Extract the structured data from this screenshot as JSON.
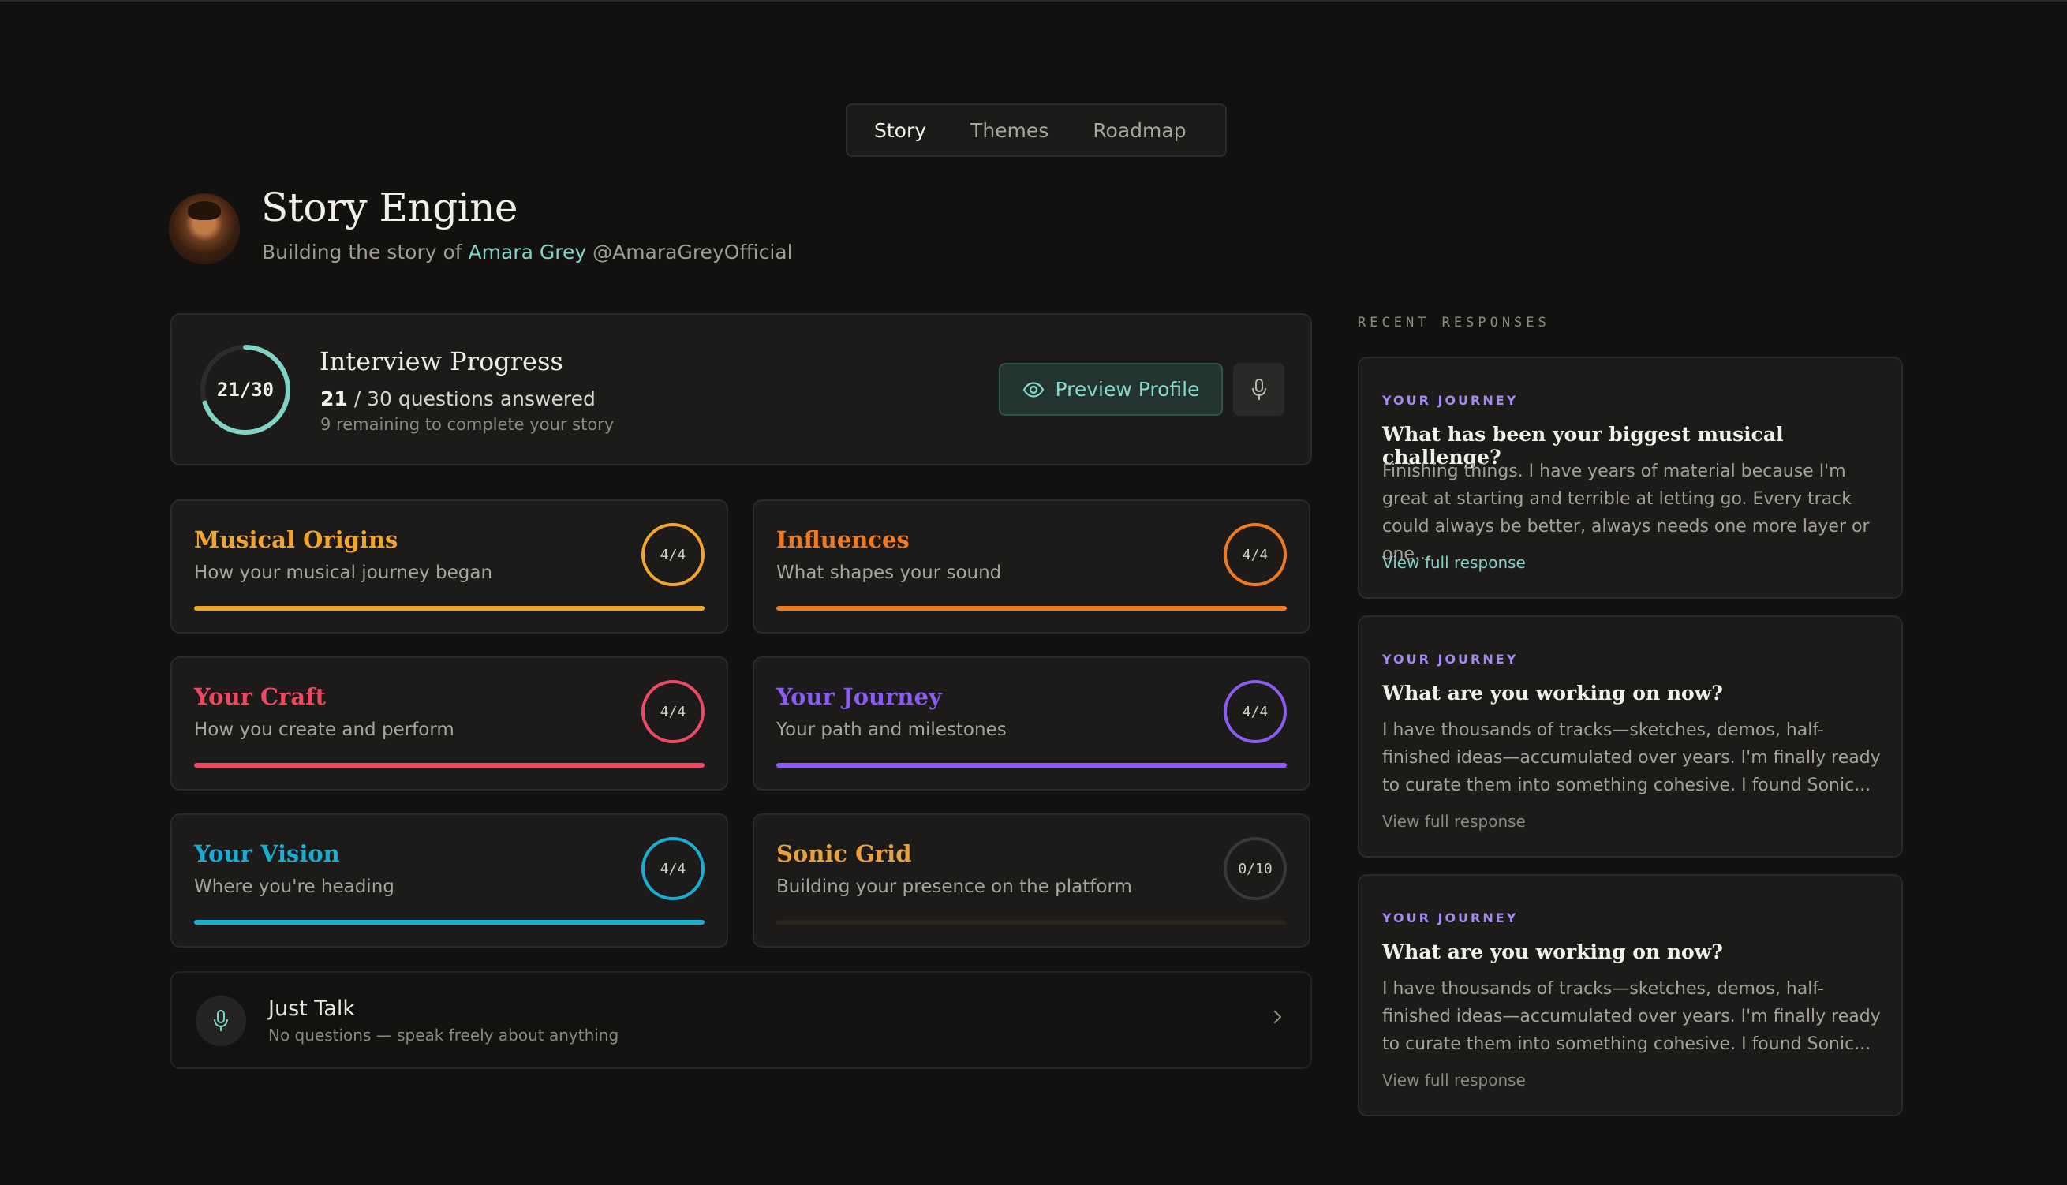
{
  "tabs": [
    {
      "label": "Story",
      "active": true
    },
    {
      "label": "Themes",
      "active": false
    },
    {
      "label": "Roadmap",
      "active": false
    }
  ],
  "header": {
    "title": "Story Engine",
    "subtitle_prefix": "Building the story of ",
    "artist_name": "Amara Grey",
    "handle": " @AmaraGreyOfficial"
  },
  "progress": {
    "ring_label": "21/30",
    "answered": 21,
    "total": 30,
    "fraction": 0.7,
    "title": "Interview Progress",
    "answered_text": "21",
    "count_suffix": " / 30 questions answered",
    "remaining_text": "9 remaining to complete your story",
    "preview_label": "Preview Profile",
    "accent": "#7fd3c7"
  },
  "categories": [
    {
      "title": "Musical Origins",
      "subtitle": "How your musical journey began",
      "count": "4/4",
      "fraction": 1,
      "color": "#f2a52a"
    },
    {
      "title": "Influences",
      "subtitle": "What shapes your sound",
      "count": "4/4",
      "fraction": 1,
      "color": "#f07a1e"
    },
    {
      "title": "Your Craft",
      "subtitle": "How you create and perform",
      "count": "4/4",
      "fraction": 1,
      "color": "#ec4a63"
    },
    {
      "title": "Your Journey",
      "subtitle": "Your path and milestones",
      "count": "4/4",
      "fraction": 1,
      "color": "#8a5cf0"
    },
    {
      "title": "Your Vision",
      "subtitle": "Where you're heading",
      "count": "4/4",
      "fraction": 1,
      "color": "#18aed3"
    },
    {
      "title": "Sonic Grid",
      "subtitle": "Building your presence on the platform",
      "count": "0/10",
      "fraction": 0,
      "color": "#e8a23c"
    }
  ],
  "just_talk": {
    "title": "Just Talk",
    "subtitle": "No questions — speak freely about anything"
  },
  "recent": {
    "label": "RECENT RESPONSES",
    "items": [
      {
        "tag": "YOUR JOURNEY",
        "question": "What has been your biggest musical challenge?",
        "answer": "Finishing things. I have years of material because I'm great at starting and terrible at letting go. Every track could always be better, always needs one more layer or one...",
        "link": "View full response"
      },
      {
        "tag": "YOUR JOURNEY",
        "question": "What are you working on now?",
        "answer": "I have thousands of tracks—sketches, demos, half-finished ideas—accumulated over years. I'm finally ready to curate them into something cohesive. I found Sonic...",
        "link": "View full response"
      },
      {
        "tag": "YOUR JOURNEY",
        "question": "What are you working on now?",
        "answer": "I have thousands of tracks—sketches, demos, half-finished ideas—accumulated over years. I'm finally ready to curate them into something cohesive. I found Sonic...",
        "link": "View full response"
      }
    ]
  },
  "icons": [
    "eye-icon",
    "mic-icon",
    "chevron-right-icon"
  ]
}
